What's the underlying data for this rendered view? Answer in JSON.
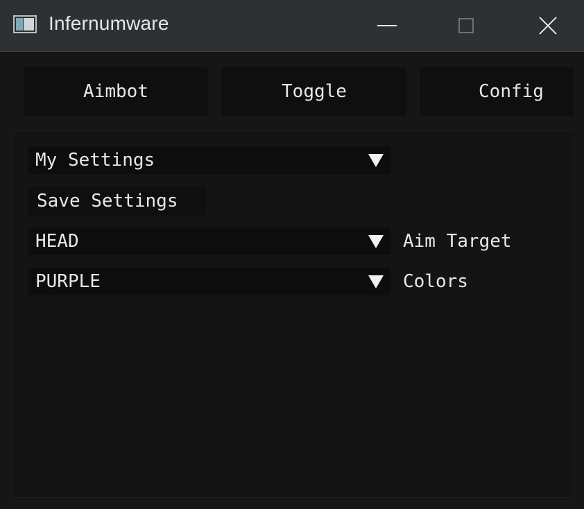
{
  "window": {
    "title": "Infernumware",
    "icon": "app-window-icon",
    "controls": {
      "minimize_icon": "minimize-icon",
      "maximize_icon": "maximize-icon",
      "close_icon": "close-icon"
    }
  },
  "tabs": [
    {
      "label": "Aimbot"
    },
    {
      "label": "Toggle"
    },
    {
      "label": "Config"
    }
  ],
  "settings": {
    "profile_combo": {
      "value": "My Settings",
      "arrow_icon": "dropdown-arrow-icon"
    },
    "save_button": {
      "label": "Save Settings"
    },
    "aim_target": {
      "value": "HEAD",
      "label": "Aim Target"
    },
    "colors": {
      "value": "PURPLE",
      "label": "Colors"
    }
  },
  "colors": {
    "titlebar": "#2d3133",
    "background": "#161616",
    "control_bg": "#0d0d0d",
    "text": "#e8e8e8"
  }
}
